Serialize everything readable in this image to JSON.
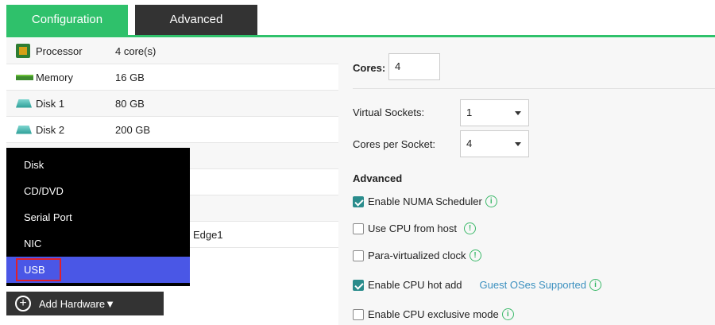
{
  "tabs": [
    {
      "label": "Configuration",
      "active": true
    },
    {
      "label": "Advanced",
      "active": false
    }
  ],
  "devices": [
    {
      "icon": "processor-icon",
      "name": "Processor",
      "value": "4 core(s)"
    },
    {
      "icon": "memory-icon",
      "name": "Memory",
      "value": "16 GB"
    },
    {
      "icon": "disk-icon",
      "name": "Disk 1",
      "value": "80 GB"
    },
    {
      "icon": "disk-icon",
      "name": "Disk 2",
      "value": "200 GB"
    }
  ],
  "partial_row_text": "Edge1",
  "add_menu": {
    "items": [
      "Disk",
      "CD/DVD",
      "Serial Port",
      "NIC",
      "USB"
    ],
    "selected": "USB"
  },
  "add_hardware": {
    "label": "Add Hardware▼"
  },
  "cpu": {
    "cores_label": "Cores:",
    "cores_value": "4",
    "virtual_sockets_label": "Virtual Sockets:",
    "virtual_sockets_value": "1",
    "cores_per_socket_label": "Cores per Socket:",
    "cores_per_socket_value": "4",
    "advanced_heading": "Advanced",
    "options": [
      {
        "label": "Enable NUMA Scheduler",
        "checked": true
      },
      {
        "label": "Use CPU from host",
        "checked": false
      },
      {
        "label": "Para-virtualized clock",
        "checked": false
      },
      {
        "label": "Enable CPU hot add",
        "checked": true
      },
      {
        "label": "Enable CPU exclusive mode",
        "checked": false
      }
    ],
    "guest_os_link": "Guest OSes Supported"
  },
  "colors": {
    "accent_green": "#2fc16b",
    "dark": "#333333",
    "menu_active": "#4a57e6",
    "highlight_border": "#e0202a",
    "checkbox": "#2a8c8c",
    "link": "#3a8fbf"
  }
}
